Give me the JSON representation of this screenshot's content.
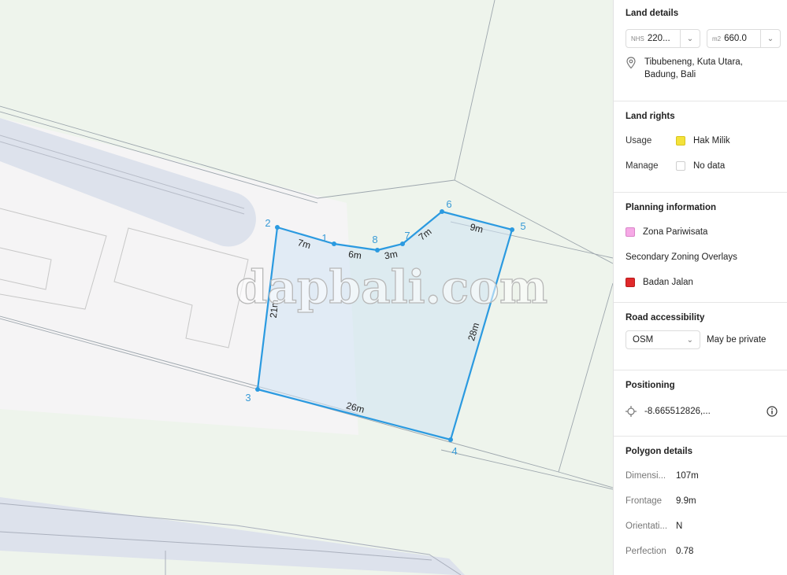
{
  "map": {
    "watermark": "dapbali.com",
    "vertex_labels": [
      "1",
      "2",
      "3",
      "4",
      "5",
      "6",
      "7",
      "8"
    ],
    "side_labels": [
      "7m",
      "6m",
      "3m",
      "7m",
      "9m",
      "28m",
      "26m",
      "21m"
    ]
  },
  "panel": {
    "land_details": {
      "title": "Land details",
      "nhs_unit": "NHS",
      "nhs_value": "220...",
      "area_unit": "m2",
      "area_value": "660.0",
      "location_line1": "Tibubeneng, Kuta Utara,",
      "location_line2": "Badung, Bali"
    },
    "land_rights": {
      "title": "Land rights",
      "usage_label": "Usage",
      "usage_value": "Hak Milik",
      "usage_color": "#f4e23a",
      "manage_label": "Manage",
      "manage_value": "No data"
    },
    "planning": {
      "title": "Planning information",
      "zone_name": "Zona Pariwisata",
      "zone_color": "#f6a9e6",
      "overlays_title": "Secondary Zoning Overlays",
      "overlay_name": "Badan Jalan",
      "overlay_color": "#e0292b"
    },
    "road": {
      "title": "Road accessibility",
      "source": "OSM",
      "status": "May be private"
    },
    "positioning": {
      "title": "Positioning",
      "coords": "-8.665512826,..."
    },
    "polygon": {
      "title": "Polygon details",
      "rows": [
        {
          "label": "Dimensi...",
          "value": "107m"
        },
        {
          "label": "Frontage",
          "value": "9.9m"
        },
        {
          "label": "Orientati...",
          "value": "N"
        },
        {
          "label": "Perfection",
          "value": "0.78"
        }
      ]
    }
  },
  "colors": {
    "parcel_stroke": "#2b9ae0",
    "parcel_fill": "#cfe4f4",
    "road_fill": "#dde2ec",
    "land_fill": "#eef4ec",
    "lot_fill": "#f5f4f5"
  }
}
